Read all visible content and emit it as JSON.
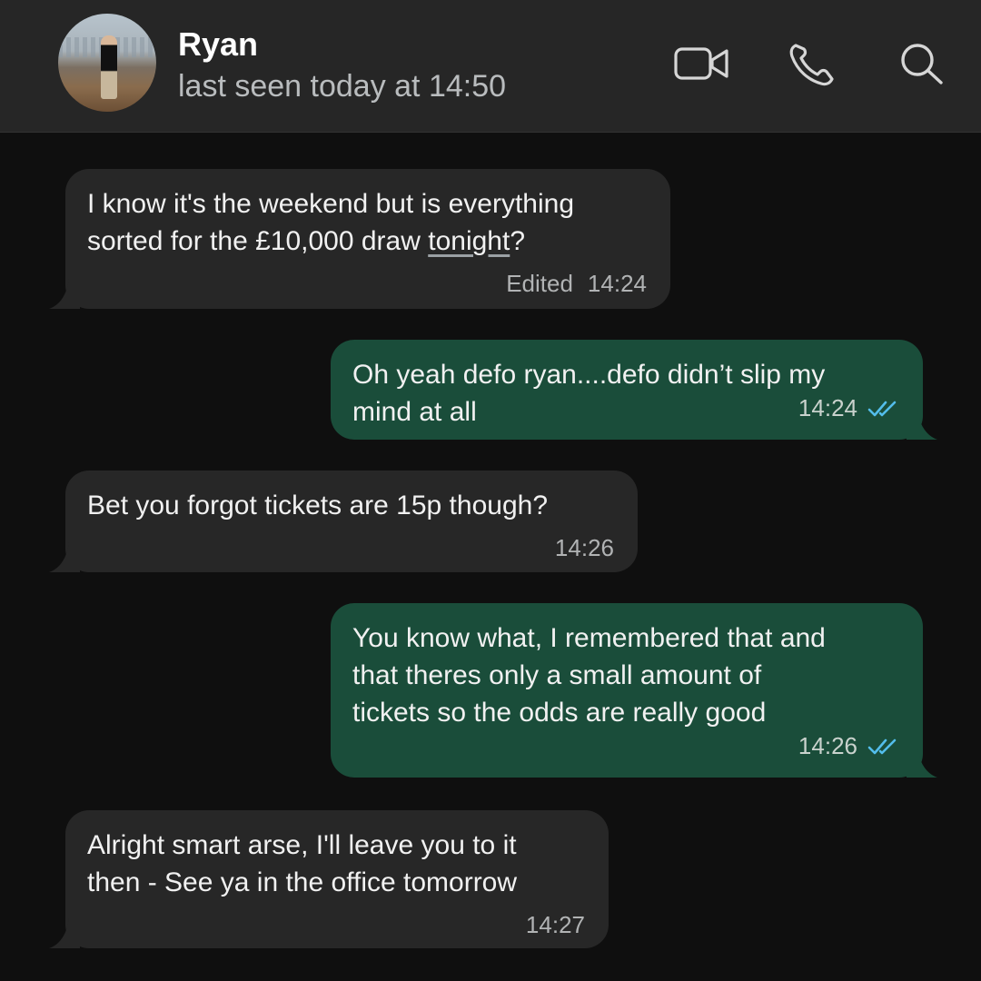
{
  "header": {
    "contact_name": "Ryan",
    "status": "last seen today at 14:50",
    "icons": [
      "video-call-icon",
      "voice-call-icon",
      "search-icon"
    ]
  },
  "messages": [
    {
      "direction": "incoming",
      "text_a": "I know it's the weekend but is everything",
      "text_b": "sorted for the £10,000 draw ",
      "text_link": "tonight",
      "text_c": "?",
      "edited_label": "Edited",
      "time": "14:24"
    },
    {
      "direction": "outgoing",
      "line1": "Oh yeah defo ryan....defo didn’t slip my",
      "line2": "mind at all",
      "time": "14:24",
      "status": "read"
    },
    {
      "direction": "incoming",
      "line1": "Bet you forgot tickets are 15p though?",
      "time": "14:26"
    },
    {
      "direction": "outgoing",
      "line1": "You know what, I remembered that and",
      "line2": "that theres only a small amount of",
      "line3": "tickets so the odds are really good",
      "time": "14:26",
      "status": "read"
    },
    {
      "direction": "incoming",
      "line1": "Alright smart arse, I'll leave you to it",
      "line2": "then - See ya in the office tomorrow",
      "time": "14:27"
    }
  ],
  "colors": {
    "incoming_bubble": "#272727",
    "outgoing_bubble": "#1a4d3a",
    "read_ticks": "#53bdeb",
    "header": "#262626"
  }
}
